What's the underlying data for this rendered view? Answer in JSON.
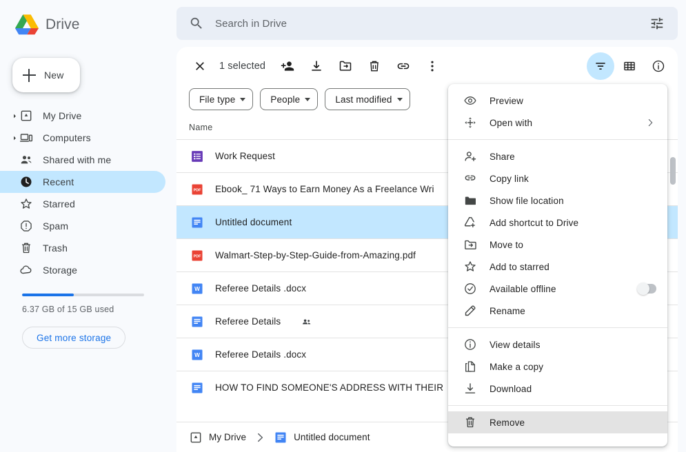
{
  "brand": {
    "name": "Drive",
    "logo_icon": "google-drive-logo"
  },
  "new_button": {
    "label": "New",
    "icon": "plus-icon"
  },
  "sidebar": {
    "items": [
      {
        "label": "My Drive",
        "icon": "my-drive-icon",
        "caret": true,
        "active": false,
        "key": "my-drive"
      },
      {
        "label": "Computers",
        "icon": "computers-icon",
        "caret": true,
        "active": false,
        "key": "computers"
      },
      {
        "label": "Shared with me",
        "icon": "shared-with-me-icon",
        "caret": false,
        "active": false,
        "key": "shared-with-me"
      },
      {
        "label": "Recent",
        "icon": "clock-icon",
        "caret": false,
        "active": true,
        "key": "recent"
      },
      {
        "label": "Starred",
        "icon": "star-icon",
        "caret": false,
        "active": false,
        "key": "starred"
      },
      {
        "label": "Spam",
        "icon": "spam-icon",
        "caret": false,
        "active": false,
        "key": "spam"
      },
      {
        "label": "Trash",
        "icon": "trash-icon",
        "caret": false,
        "active": false,
        "key": "trash"
      },
      {
        "label": "Storage",
        "icon": "cloud-icon",
        "caret": false,
        "active": false,
        "key": "storage"
      }
    ],
    "storage": {
      "used_text": "6.37 GB of 15 GB used",
      "percent": 42.5,
      "bar_color": "#1a73e8",
      "button_label": "Get more storage"
    }
  },
  "search": {
    "placeholder": "Search in Drive",
    "value": "",
    "icon": "search-icon",
    "options_icon": "search-options-icon"
  },
  "toolbar": {
    "close_icon": "close-icon",
    "selection_label": "1 selected",
    "actions": [
      {
        "name": "share-button",
        "icon": "person-add-icon"
      },
      {
        "name": "download-button",
        "icon": "download-icon"
      },
      {
        "name": "move-to-button",
        "icon": "move-to-folder-icon"
      },
      {
        "name": "remove-button",
        "icon": "trash-icon"
      },
      {
        "name": "copy-link-button",
        "icon": "link-icon"
      },
      {
        "name": "more-actions-button",
        "icon": "more-vert-icon"
      }
    ],
    "right_actions": [
      {
        "name": "filter-toggle-button",
        "icon": "filter-icon",
        "active": true
      },
      {
        "name": "grid-view-button",
        "icon": "grid-view-icon",
        "active": false
      },
      {
        "name": "details-button",
        "icon": "info-icon",
        "active": false
      }
    ]
  },
  "filters": {
    "chips": [
      {
        "label": "File type",
        "key": "file-type"
      },
      {
        "label": "People",
        "key": "people"
      },
      {
        "label": "Last modified",
        "key": "last-modified"
      }
    ]
  },
  "file_list": {
    "column_header": "Name",
    "rows": [
      {
        "name": "Work Request",
        "icon": "google-forms-icon",
        "selected": false,
        "shared": false
      },
      {
        "name": "Ebook_ 71 Ways to Earn Money As a Freelance Wri",
        "icon": "pdf-icon",
        "selected": false,
        "shared": false
      },
      {
        "name": "Untitled document",
        "icon": "google-docs-icon",
        "selected": true,
        "shared": false
      },
      {
        "name": "Walmart-Step-by-Step-Guide-from-Amazing.pdf",
        "icon": "pdf-icon",
        "selected": false,
        "shared": false
      },
      {
        "name": "Referee Details .docx",
        "icon": "word-icon",
        "selected": false,
        "shared": false
      },
      {
        "name": "Referee Details",
        "icon": "google-docs-icon",
        "selected": false,
        "shared": true
      },
      {
        "name": "Referee Details .docx",
        "icon": "word-icon",
        "selected": false,
        "shared": false
      },
      {
        "name": "HOW TO FIND SOMEONE'S ADDRESS WITH THEIR",
        "icon": "google-docs-icon",
        "selected": false,
        "shared": false
      }
    ]
  },
  "breadcrumb": {
    "items": [
      {
        "label": "My Drive",
        "icon": "my-drive-icon"
      },
      {
        "label": "Untitled document",
        "icon": "google-docs-icon"
      }
    ],
    "separator_icon": "chevron-right-icon"
  },
  "context_menu": {
    "groups": [
      {
        "items": [
          {
            "label": "Preview",
            "icon": "eye-icon",
            "key": "preview"
          },
          {
            "label": "Open with",
            "icon": "open-with-icon",
            "key": "open-with",
            "submenu": true
          }
        ]
      },
      {
        "items": [
          {
            "label": "Share",
            "icon": "person-add-icon",
            "key": "share"
          },
          {
            "label": "Copy link",
            "icon": "link-icon",
            "key": "copy-link"
          },
          {
            "label": "Show file location",
            "icon": "folder-icon",
            "key": "show-file-location"
          },
          {
            "label": "Add shortcut to Drive",
            "icon": "add-shortcut-icon",
            "key": "add-shortcut-to-drive"
          },
          {
            "label": "Move to",
            "icon": "move-to-folder-icon",
            "key": "move-to"
          },
          {
            "label": "Add to starred",
            "icon": "star-icon",
            "key": "add-to-starred"
          },
          {
            "label": "Available offline",
            "icon": "offline-check-icon",
            "key": "available-offline",
            "toggle": true,
            "toggle_on": false
          },
          {
            "label": "Rename",
            "icon": "pencil-icon",
            "key": "rename"
          }
        ]
      },
      {
        "items": [
          {
            "label": "View details",
            "icon": "info-icon",
            "key": "view-details"
          },
          {
            "label": "Make a copy",
            "icon": "copy-icon",
            "key": "make-a-copy"
          },
          {
            "label": "Download",
            "icon": "download-icon",
            "key": "download"
          }
        ]
      },
      {
        "items": [
          {
            "label": "Remove",
            "icon": "trash-icon",
            "key": "remove",
            "highlighted": true
          }
        ]
      }
    ]
  },
  "colors": {
    "accent_blue": "#1a73e8",
    "selection_blue": "#c2e7ff",
    "sidebar_bg": "#f8fafd",
    "pdf_red": "#ea4335",
    "forms_purple": "#673ab7",
    "docs_blue": "#4285f4",
    "word_blue": "#4285f4"
  }
}
